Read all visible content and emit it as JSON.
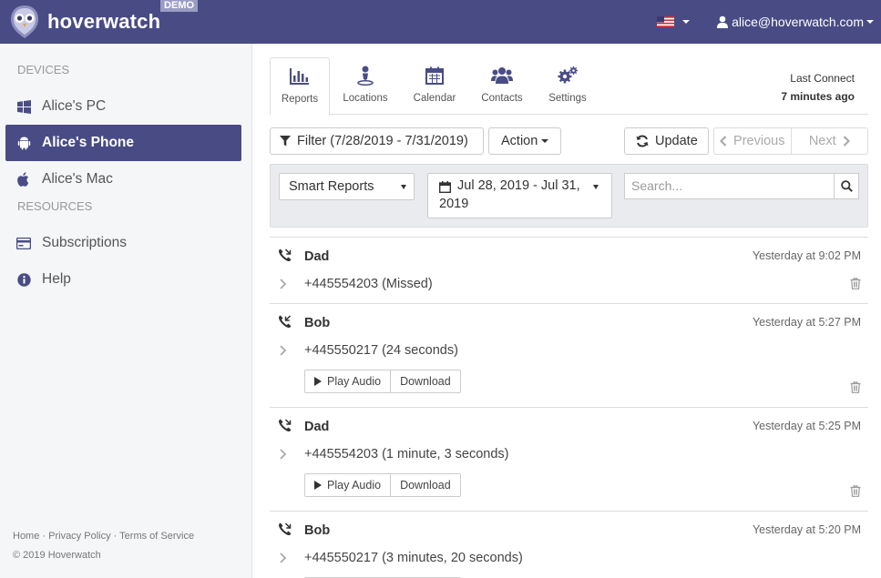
{
  "app": {
    "brand": "hoverwatch",
    "badge": "DEMO",
    "user_email": "alice@hoverwatch.com"
  },
  "sidebar": {
    "devices_heading": "DEVICES",
    "devices": [
      {
        "label": "Alice's PC",
        "icon": "windows-icon",
        "active": false
      },
      {
        "label": "Alice's Phone",
        "icon": "android-icon",
        "active": true
      },
      {
        "label": "Alice's Mac",
        "icon": "apple-icon",
        "active": false
      }
    ],
    "resources_heading": "RESOURCES",
    "resources": [
      {
        "label": "Subscriptions",
        "icon": "credit-card-icon"
      },
      {
        "label": "Help",
        "icon": "info-icon"
      }
    ],
    "footer": {
      "home": "Home",
      "sep": " · ",
      "privacy": "Privacy Policy",
      "terms": "Terms of Service",
      "copyright": "© 2019 Hoverwatch"
    }
  },
  "tabs": [
    {
      "label": "Reports",
      "icon": "bar-chart-icon",
      "active": true
    },
    {
      "label": "Locations",
      "icon": "map-marker-icon",
      "active": false
    },
    {
      "label": "Calendar",
      "icon": "calendar-icon",
      "active": false
    },
    {
      "label": "Contacts",
      "icon": "users-icon",
      "active": false
    },
    {
      "label": "Settings",
      "icon": "gears-icon",
      "active": false
    }
  ],
  "last_connect": {
    "label": "Last Connect",
    "value": "7 minutes ago"
  },
  "toolbar": {
    "filter_label": "Filter (7/28/2019 - 7/31/2019)",
    "action_label": "Action",
    "update_label": "Update",
    "previous_label": "Previous",
    "next_label": "Next"
  },
  "filters": {
    "report_type": "Smart Reports",
    "date_range_line1": "Jul 28, 2019 - Jul 31,",
    "date_range_line2": "2019",
    "search_placeholder": "Search..."
  },
  "records": [
    {
      "name": "Dad",
      "time": "Yesterday at 9:02 PM",
      "detail": "+445554203 (Missed)",
      "has_audio": false
    },
    {
      "name": "Bob",
      "time": "Yesterday at 5:27 PM",
      "detail": "+445550217 (24 seconds)",
      "has_audio": true
    },
    {
      "name": "Dad",
      "time": "Yesterday at 5:25 PM",
      "detail": "+445554203 (1 minute, 3 seconds)",
      "has_audio": true
    },
    {
      "name": "Bob",
      "time": "Yesterday at 5:20 PM",
      "detail": "+445550217 (3 minutes, 20 seconds)",
      "has_audio": true
    }
  ],
  "audio": {
    "play_label": "Play Audio",
    "download_label": "Download"
  },
  "colors": {
    "primary": "#494b85",
    "sidebar_bg": "#f5f6f8",
    "filter_bg": "#eaebef"
  }
}
